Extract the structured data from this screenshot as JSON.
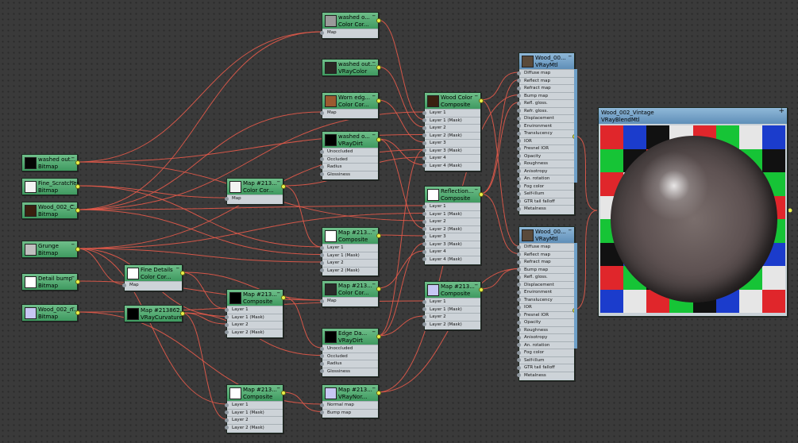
{
  "colors": {
    "wire": "#e45a4a",
    "socket": "#e9f04a",
    "map_header": "#4fa86c",
    "mtl_header": "#7ba7cc",
    "checker": [
      "#e0262b",
      "#1b3ccc",
      "#16c436",
      "#e6e6e6",
      "#111111"
    ]
  },
  "nodes": {
    "washed_bitmap": {
      "name": "washed out...",
      "type": "Bitmap"
    },
    "fine_scratches": {
      "name": "Fine_Scratches",
      "type": "Bitmap"
    },
    "wood_c_bitmap": {
      "name": "Wood_002_C...",
      "type": "Bitmap"
    },
    "grunge": {
      "name": "Grunge",
      "type": "Bitmap"
    },
    "detail_bump": {
      "name": "Detail bump",
      "type": "Bitmap"
    },
    "wood_n_bitmap": {
      "name": "Wood_002_n...",
      "type": "Bitmap"
    },
    "fine_details": {
      "name": "Fine Details",
      "type": "Color Cor...",
      "slots": [
        "Map"
      ]
    },
    "curvature": {
      "name": "Map #213862...",
      "type": "VRayCurvature"
    },
    "cc_mid": {
      "name": "Map #213...",
      "type": "Color Cor...",
      "slots": [
        "Map"
      ]
    },
    "comp_a": {
      "name": "Map #213...",
      "type": "Composite",
      "slots": [
        "Layer 1",
        "Layer 1 (Mask)",
        "Layer 2",
        "Layer 2 (Mask)"
      ]
    },
    "comp_b": {
      "name": "Map #213...",
      "type": "Composite",
      "slots": [
        "Layer 1",
        "Layer 1 (Mask)",
        "Layer 2",
        "Layer 2 (Mask)"
      ]
    },
    "washed_cc": {
      "name": "washed o...",
      "type": "Color Cor...",
      "slots": [
        "Map"
      ]
    },
    "washed_color": {
      "name": "washed out...",
      "type": "VRayColor"
    },
    "worn_edges": {
      "name": "Worn edg...",
      "type": "Color Cor...",
      "slots": [
        "Map"
      ]
    },
    "washed_dirt": {
      "name": "washed o...",
      "type": "VRayDirt",
      "slots": [
        "Unoccluded",
        "Occluded",
        "Radius",
        "Glossiness"
      ]
    },
    "comp_c": {
      "name": "Map #213...",
      "type": "Composite",
      "slots": [
        "Layer 1",
        "Layer 1 (Mask)",
        "Layer 2",
        "Layer 2 (Mask)"
      ]
    },
    "cc_c": {
      "name": "Map #213...",
      "type": "Color Cor...",
      "slots": [
        "Map"
      ]
    },
    "edge_dirt": {
      "name": "Edge Da...",
      "type": "VRayDirt",
      "slots": [
        "Unoccluded",
        "Occluded",
        "Radius",
        "Glossiness"
      ]
    },
    "normal": {
      "name": "Map #213...",
      "type": "VRayNor...",
      "slots": [
        "Normal map",
        "Bump map"
      ]
    },
    "wood_composite": {
      "name": "Wood Color",
      "type": "Composite",
      "slots": [
        "Layer 1",
        "Layer 1 (Mask)",
        "Layer 2",
        "Layer 2 (Mask)",
        "Layer 3",
        "Layer 3 (Mask)",
        "Layer 4",
        "Layer 4 (Mask)"
      ]
    },
    "refl_composite": {
      "name": "Reflection...",
      "type": "Composite",
      "slots": [
        "Layer 1",
        "Layer 1 (Mask)",
        "Layer 2",
        "Layer 2 (Mask)",
        "Layer 3",
        "Layer 3 (Mask)",
        "Layer 4",
        "Layer 4 (Mask)"
      ]
    },
    "comp_d": {
      "name": "Map #213...",
      "type": "Composite",
      "slots": [
        "Layer 1",
        "Layer 1 (Mask)",
        "Layer 2",
        "Layer 2 (Mask)"
      ]
    },
    "vraymtl_1": {
      "name": "Wood_00...",
      "type": "VRayMtl",
      "slots": [
        "Diffuse map",
        "Reflect map",
        "Refract map",
        "Bump map",
        "Refl. gloss.",
        "Refr. gloss.",
        "Displacement",
        "Environment",
        "Translucency",
        "IOR",
        "Fresnel IOR",
        "Opacity",
        "Roughness",
        "Anisotropy",
        "An. rotation",
        "Fog color",
        "Self-illum",
        "GTR tail falloff",
        "Metalness"
      ]
    },
    "vraymtl_2": {
      "name": "Wood_00...",
      "type": "VRayMtl",
      "slots": [
        "Diffuse map",
        "Reflect map",
        "Refract map",
        "Bump map",
        "Refl. gloss.",
        "Displacement",
        "Environment",
        "Translucency",
        "IOR",
        "Fresnel IOR",
        "Opacity",
        "Roughness",
        "Anisotropy",
        "An. rotation",
        "Fog color",
        "Self-illum",
        "GTR tail falloff",
        "Metalness"
      ]
    },
    "blend": {
      "name": "Wood_002_Vintage",
      "type": "VRayBlendMtl"
    }
  }
}
